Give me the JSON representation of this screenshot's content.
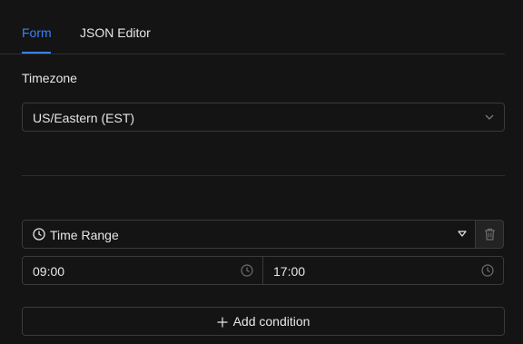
{
  "tabs": [
    {
      "label": "Form",
      "active": true
    },
    {
      "label": "JSON Editor",
      "active": false
    }
  ],
  "timezone": {
    "label": "Timezone",
    "selected": "US/Eastern (EST)"
  },
  "condition": {
    "type": "Time Range",
    "start": "09:00",
    "end": "17:00"
  },
  "actions": {
    "add_condition": "Add condition"
  },
  "icons": {
    "select": "chevron-down-icon",
    "condition": "clock-icon",
    "caret": "caret-down-icon",
    "delete": "trash-icon",
    "time": "clock-icon",
    "add": "plus-icon"
  },
  "colors": {
    "accent": "#3b82f6",
    "background": "#141414",
    "border": "#3a3a3a",
    "text": "#e6e6e6"
  }
}
